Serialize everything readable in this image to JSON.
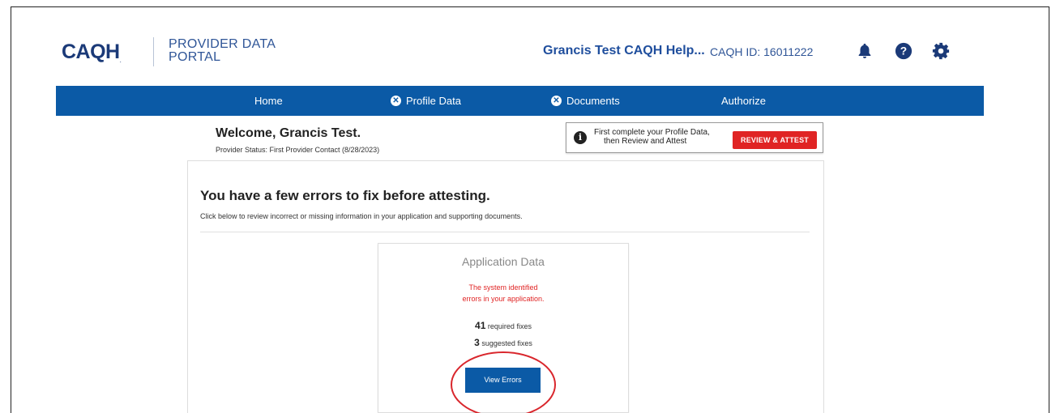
{
  "header": {
    "logo": "CAQH",
    "portal_line1": "PROVIDER DATA",
    "portal_line2": "PORTAL",
    "user_name": "Grancis Test CAQH Help...",
    "caqh_id": "CAQH ID: 16011222",
    "icons": [
      "bell-icon",
      "help-icon",
      "gear-icon"
    ]
  },
  "nav": {
    "items": [
      {
        "label": "Home",
        "icon": ""
      },
      {
        "label": "Profile Data",
        "icon": "x-circle-icon"
      },
      {
        "label": "Documents",
        "icon": "x-circle-icon"
      },
      {
        "label": "Authorize",
        "icon": ""
      }
    ]
  },
  "welcome": {
    "title": "Welcome, Grancis Test.",
    "status": "Provider Status: First Provider Contact (8/28/2023)"
  },
  "alert": {
    "line1": "First complete your Profile Data,",
    "line2": "then Review and Attest",
    "button": "REVIEW & ATTEST"
  },
  "main": {
    "title": "You have a few errors to fix before attesting.",
    "subtitle": "Click below to review incorrect or missing information in your application and supporting documents."
  },
  "application_card": {
    "title": "Application Data",
    "error_line1": "The system identified",
    "error_line2": "errors in your application.",
    "required_count": "41",
    "required_label": "required fixes",
    "suggested_count": "3",
    "suggested_label": "suggested fixes",
    "button": "View Errors"
  },
  "colors": {
    "brand_blue": "#0b5aa6",
    "alert_red": "#e02424",
    "annotation_red": "#d9262c"
  }
}
